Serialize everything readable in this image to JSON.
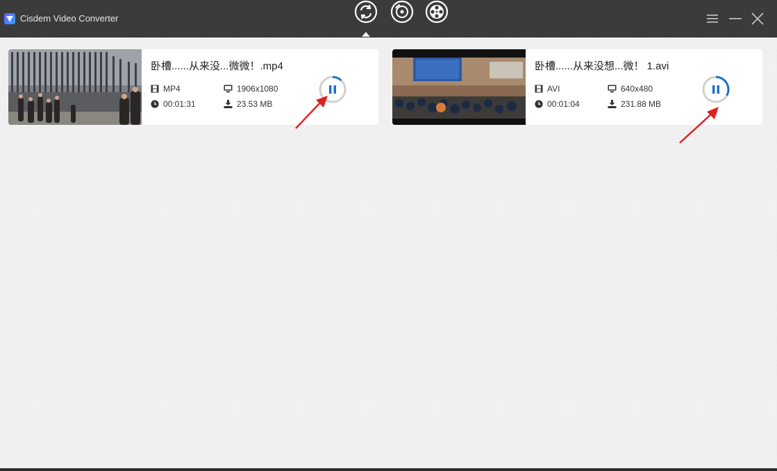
{
  "app": {
    "title": "Cisdem Video Converter"
  },
  "toolbar": {
    "modes": [
      {
        "name": "convert",
        "icon": "convert-icon",
        "active": true
      },
      {
        "name": "rip-dvd",
        "icon": "disc-icon",
        "active": false
      },
      {
        "name": "download",
        "icon": "film-reel-icon",
        "active": false
      }
    ],
    "window_controls": [
      "menu-icon",
      "minimize-icon",
      "close-icon"
    ]
  },
  "files": [
    {
      "name": "卧槽......从来没...微微！.mp4",
      "format": "MP4",
      "resolution": "1906x1080",
      "duration": "00:01:31",
      "size": "23.53 MB",
      "progress": 0.12,
      "state": "converting"
    },
    {
      "name": "卧槽......从来没想...微！ 1.avi",
      "format": "AVI",
      "resolution": "640x480",
      "duration": "00:01:04",
      "size": "231.88 MB",
      "progress": 0.33,
      "state": "converting"
    }
  ],
  "colors": {
    "titlebar": "#3b3b3b",
    "content_bg": "#f1f1f1",
    "accent": "#1f6fc5",
    "annotation_arrow": "#e02020"
  }
}
